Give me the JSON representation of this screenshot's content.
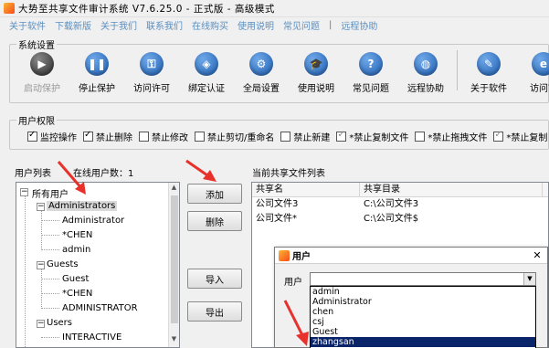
{
  "window": {
    "title": "大势至共享文件审计系统 V7.6.25.0 - 正式版 - 高级模式"
  },
  "menu": [
    "关于软件",
    "下载新版",
    "关于我们",
    "联系我们",
    "在线购买",
    "使用说明",
    "常见问题",
    "|",
    "远程协助"
  ],
  "system_settings": {
    "label": "系统设置",
    "buttons": [
      {
        "label": "启动保护",
        "icon": "play-icon",
        "color": "#3a3a3a",
        "glyph": "▶",
        "disabled": true
      },
      {
        "label": "停止保护",
        "icon": "pause-icon",
        "color": "#1e5fb4",
        "glyph": "❚❚"
      },
      {
        "label": "访问许可",
        "icon": "key-icon",
        "color": "#1e5fb4",
        "glyph": "⚿"
      },
      {
        "label": "绑定认证",
        "icon": "shield-icon",
        "color": "#1e5fb4",
        "glyph": "◈"
      },
      {
        "label": "全局设置",
        "icon": "gear-icon",
        "color": "#1e5fb4",
        "glyph": "⚙"
      },
      {
        "label": "使用说明",
        "icon": "graduation-cap-icon",
        "color": "#1e5fb4",
        "glyph": "🎓"
      },
      {
        "label": "常见问题",
        "icon": "question-icon",
        "color": "#1e5fb4",
        "glyph": "?"
      },
      {
        "label": "远程协助",
        "icon": "globe-icon",
        "color": "#1e5fb4",
        "glyph": "◍"
      },
      {
        "label": "关于软件",
        "icon": "info-icon",
        "color": "#1e5fb4",
        "glyph": "✎"
      },
      {
        "label": "访问官",
        "icon": "ie-icon",
        "color": "#1e5fb4",
        "glyph": "e"
      }
    ]
  },
  "permissions": {
    "label": "用户权限",
    "items": [
      {
        "label": "监控操作",
        "checked": true
      },
      {
        "label": "禁止删除",
        "checked": true
      },
      {
        "label": "禁止修改",
        "checked": false
      },
      {
        "label": "禁止剪切/重命名",
        "checked": false
      },
      {
        "label": "禁止新建",
        "checked": false
      },
      {
        "label": "*禁止复制文件",
        "checked": true,
        "grey": true
      },
      {
        "label": "*禁止拖拽文件",
        "checked": false
      },
      {
        "label": "*禁止复制",
        "checked": true,
        "grey": true
      }
    ]
  },
  "users": {
    "list_label": "用户列表",
    "online_label": "在线用户数：1",
    "tree": {
      "root": "所有用户",
      "groups": [
        {
          "name": "Administrators",
          "members": [
            "Administrator",
            "*CHEN",
            "admin"
          ]
        },
        {
          "name": "Guests",
          "members": [
            "Guest",
            "*CHEN",
            "ADMINISTRATOR"
          ]
        },
        {
          "name": "Users",
          "members": [
            "INTERACTIVE"
          ]
        }
      ]
    }
  },
  "actions": {
    "add": "添加",
    "delete": "删除",
    "import": "导入",
    "export": "导出"
  },
  "shares": {
    "label": "当前共享文件列表",
    "columns": [
      "共享名",
      "共享目录"
    ],
    "rows": [
      [
        "公司文件3",
        "C:\\公司文件3"
      ],
      [
        "公司文件*",
        "C:\\公司文件$"
      ]
    ]
  },
  "dialog": {
    "title": "用户",
    "field_label": "用户",
    "options": [
      "admin",
      "Administrator",
      "chen",
      "csj",
      "Guest",
      "zhangsan"
    ],
    "selected_index": 5
  },
  "colors": {
    "menu_link": "#5a8fc0",
    "arrow": "#e8312a",
    "selection": "#0a246a"
  }
}
